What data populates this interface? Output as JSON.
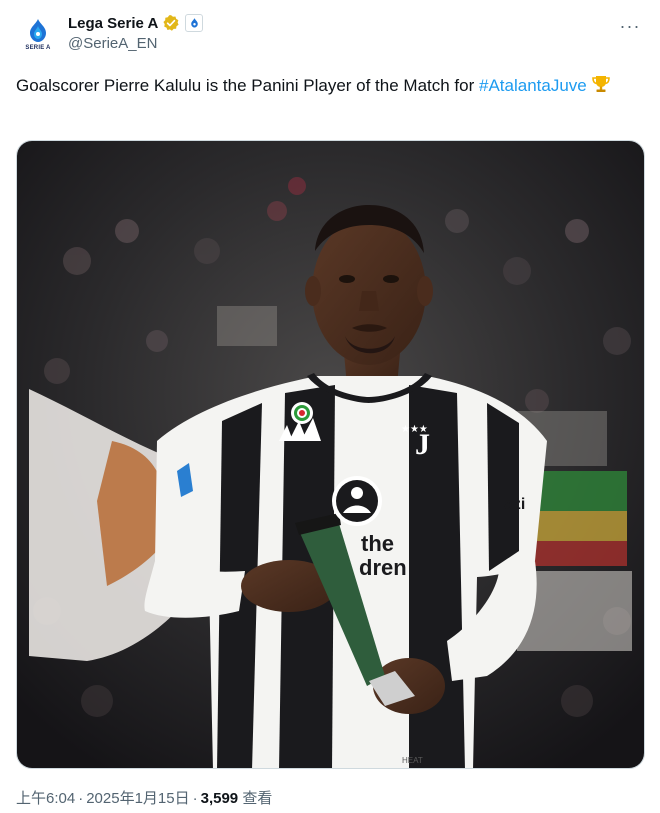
{
  "account": {
    "display_name": "Lega Serie A",
    "handle": "@SerieA_EN",
    "avatar_text": "SERIE A",
    "verified_badge": "gold-verified-check",
    "affiliation_badge": "serie-a-logo"
  },
  "menu": {
    "more_label": "···"
  },
  "tweet": {
    "text_before": "Goalscorer Pierre Kalulu is the Panini Player of the Match for ",
    "hashtag": "#AtalantaJuve",
    "emoji": "trophy"
  },
  "media": {
    "shirt_sponsor_1": "the",
    "shirt_sponsor_2": "dren",
    "sleeve_text": "azi",
    "hem_text": "HEAT"
  },
  "meta": {
    "time": "上午6:04",
    "date": "2025年1月15日",
    "views_count": "3,599",
    "views_label": "查看"
  },
  "colors": {
    "link": "#1d9bf0",
    "verified": "#e2b719",
    "secondary_text": "#536471"
  }
}
